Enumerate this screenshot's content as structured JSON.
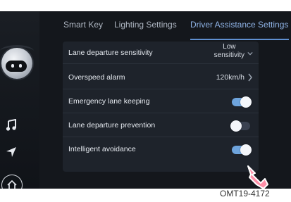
{
  "tabs": [
    {
      "label": "Smart Key",
      "active": false
    },
    {
      "label": "Lighting Settings",
      "active": false
    },
    {
      "label": "Driver Assistance Settings",
      "active": true
    }
  ],
  "settings": [
    {
      "label": "Lane departure sensitivity",
      "value_line1": "Low",
      "value_line2": "sensitivity",
      "control": "dropdown"
    },
    {
      "label": "Overspeed alarm",
      "value": "120km/h",
      "control": "chevron-right"
    },
    {
      "label": "Emergency lane keeping",
      "control": "toggle",
      "on": true
    },
    {
      "label": "Lane departure prevention",
      "control": "toggle",
      "on": false
    },
    {
      "label": "Intelligent avoidance",
      "control": "toggle",
      "on": true
    }
  ],
  "sidebar": {
    "icons": [
      "avatar",
      "music-icon",
      "navigation-icon",
      "home-icon"
    ]
  },
  "caption": "OMT19-4172",
  "colors": {
    "background": "#14171c",
    "panel": "#1e232b",
    "accent": "#6ea4dd",
    "active_tab": "#8fb3e6",
    "pointer": "#ff8fa8"
  }
}
